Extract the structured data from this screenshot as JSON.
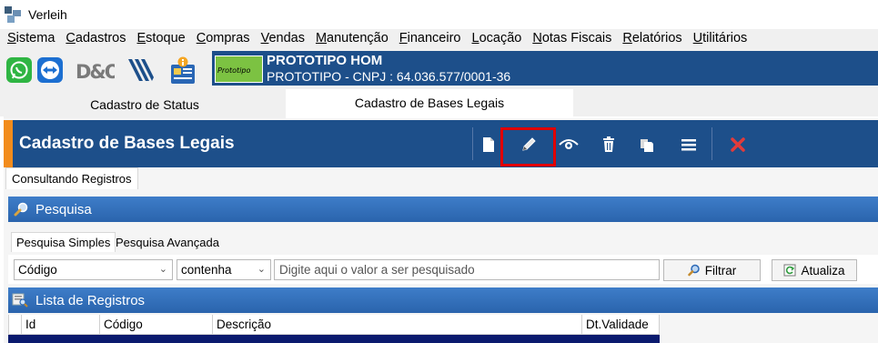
{
  "window": {
    "title": "Verleih"
  },
  "menu": [
    "Sistema",
    "Cadastros",
    "Estoque",
    "Compras",
    "Vendas",
    "Manutenção",
    "Financeiro",
    "Locação",
    "Notas Fiscais",
    "Relatórios",
    "Utilitários"
  ],
  "quick_icons": [
    "whatsapp-icon",
    "teamviewer-icon",
    "dio-logo-icon",
    "vektor-logo-icon",
    "info-id-card-icon"
  ],
  "company": {
    "logo_text": "Prototipo",
    "name": "PROTOTIPO HOM",
    "cnpj_line": "PROTOTIPO - CNPJ : 64.036.577/0001-36"
  },
  "tabs": [
    {
      "label": "Cadastro de Status",
      "active": false
    },
    {
      "label": "Cadastro de Bases Legais",
      "active": true
    }
  ],
  "form": {
    "title": "Cadastro de Bases Legais",
    "toolbar": [
      "new-document-icon",
      "edit-pencil-icon",
      "view-eye-icon",
      "delete-trash-icon",
      "copy-icon",
      "list-menu-icon",
      "close-x-icon"
    ],
    "mode_tab": "Consultando Registros"
  },
  "search": {
    "section_title": "Pesquisa",
    "tabs": [
      "Pesquisa Simples",
      "Pesquisa Avançada"
    ],
    "field_select": "Código",
    "operator_select": "contenha",
    "input_placeholder": "Digite aqui o valor a ser pesquisado",
    "filter_button": "Filtrar",
    "refresh_button": "Atualiza"
  },
  "list": {
    "section_title": "Lista de Registros",
    "columns": [
      "Id",
      "Código",
      "Descrição",
      "Dt.Validade"
    ]
  },
  "colors": {
    "header_blue": "#1d4f8a",
    "accent_orange": "#f28c1c",
    "section_blue": "#2a67b5",
    "highlight_red": "#e00000"
  }
}
